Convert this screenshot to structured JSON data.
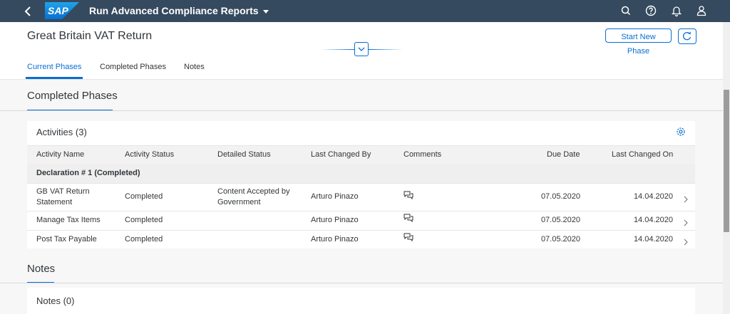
{
  "shell": {
    "app_title": "Run Advanced Compliance Reports",
    "logo_text": "SAP",
    "icons": [
      "back-icon",
      "search-icon",
      "help-icon",
      "notifications-icon",
      "user-icon"
    ],
    "bar_color": "#354a5f"
  },
  "header": {
    "title": "Great Britain VAT Return",
    "start_new_phase": "Start New Phase",
    "tabs": [
      "Current Phases",
      "Completed Phases",
      "Notes"
    ],
    "active_tab": "Current Phases"
  },
  "completed_section": {
    "title": "Completed Phases",
    "activities": {
      "heading": "Activities (3)",
      "columns": [
        "Activity Name",
        "Activity Status",
        "Detailed Status",
        "Last Changed By",
        "Comments",
        "Due Date",
        "Last Changed On"
      ],
      "group": "Declaration # 1 (Completed)",
      "rows": [
        {
          "name_line1": "GB VAT Return",
          "name_line2": "Statement",
          "status": "Completed",
          "detail_line1": "Content Accepted by",
          "detail_line2": "Government",
          "changed_by": "Arturo Pinazo",
          "due_date": "07.05.2020",
          "changed_on": "14.04.2020"
        },
        {
          "name_line1": "Manage Tax Items",
          "name_line2": "",
          "status": "Completed",
          "detail_line1": "",
          "detail_line2": "",
          "changed_by": "Arturo Pinazo",
          "due_date": "07.05.2020",
          "changed_on": "14.04.2020"
        },
        {
          "name_line1": "Post Tax Payable",
          "name_line2": "",
          "status": "Completed",
          "detail_line1": "",
          "detail_line2": "",
          "changed_by": "Arturo Pinazo",
          "due_date": "07.05.2020",
          "changed_on": "14.04.2020"
        }
      ]
    }
  },
  "notes_section": {
    "title": "Notes",
    "heading": "Notes (0)"
  },
  "colors": {
    "accent": "#0a6ed1",
    "shell": "#354a5f"
  }
}
